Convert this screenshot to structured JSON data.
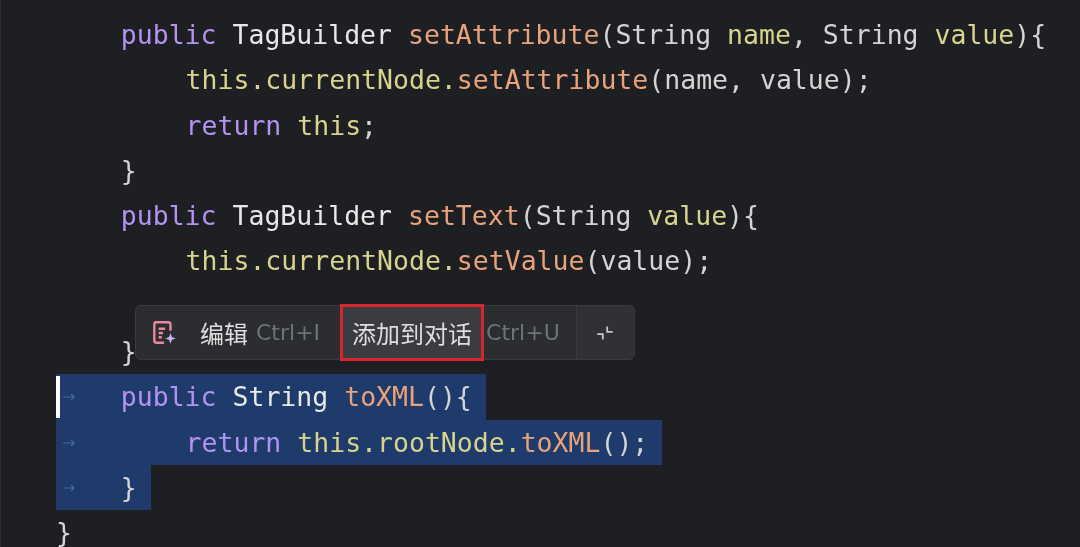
{
  "code_lines": [
    {
      "kind": "member",
      "selected": false,
      "caret": false,
      "tokens": [
        {
          "kind": "keyword",
          "text": "public "
        },
        {
          "kind": "type",
          "text": "TagBuilder "
        },
        {
          "kind": "method",
          "text": "setAttribute"
        },
        {
          "kind": "plain",
          "text": "(String "
        },
        {
          "kind": "field",
          "text": "name"
        },
        {
          "kind": "plain",
          "text": ", String "
        },
        {
          "kind": "field",
          "text": "value"
        },
        {
          "kind": "plain",
          "text": "){"
        }
      ]
    },
    {
      "kind": "statement",
      "selected": false,
      "caret": false,
      "tokens": [
        {
          "kind": "field",
          "text": "this.currentNode."
        },
        {
          "kind": "method",
          "text": "setAttribute"
        },
        {
          "kind": "plain",
          "text": "(name, value);"
        }
      ]
    },
    {
      "kind": "statement",
      "selected": false,
      "caret": false,
      "tokens": [
        {
          "kind": "keyword",
          "text": "return "
        },
        {
          "kind": "field",
          "text": "this"
        },
        {
          "kind": "plain",
          "text": ";"
        }
      ]
    },
    {
      "kind": "member",
      "selected": false,
      "caret": false,
      "tokens": [
        {
          "kind": "plain",
          "text": "}"
        }
      ]
    },
    {
      "kind": "member",
      "selected": false,
      "caret": false,
      "tokens": [
        {
          "kind": "keyword",
          "text": "public "
        },
        {
          "kind": "type",
          "text": "TagBuilder "
        },
        {
          "kind": "method",
          "text": "setText"
        },
        {
          "kind": "plain",
          "text": "(String "
        },
        {
          "kind": "field",
          "text": "value"
        },
        {
          "kind": "plain",
          "text": "){"
        }
      ]
    },
    {
      "kind": "statement",
      "selected": false,
      "caret": false,
      "tokens": [
        {
          "kind": "field",
          "text": "this.currentNode."
        },
        {
          "kind": "method",
          "text": "setValue"
        },
        {
          "kind": "plain",
          "text": "(value);"
        }
      ]
    }
  ],
  "code_lines_below": [
    {
      "kind": "member",
      "selected": false,
      "caret": false,
      "tokens": [
        {
          "kind": "plain",
          "text": "}"
        }
      ]
    },
    {
      "kind": "member",
      "selected": true,
      "caret": true,
      "tokens": [
        {
          "kind": "keyword",
          "text": "public "
        },
        {
          "kind": "type",
          "text": "String "
        },
        {
          "kind": "method",
          "text": "toXML"
        },
        {
          "kind": "plain",
          "text": "(){"
        }
      ]
    },
    {
      "kind": "statement",
      "selected": true,
      "caret": false,
      "tokens": [
        {
          "kind": "keyword",
          "text": "return "
        },
        {
          "kind": "field",
          "text": "this.rootNode."
        },
        {
          "kind": "method",
          "text": "toXML"
        },
        {
          "kind": "plain",
          "text": "();"
        }
      ]
    },
    {
      "kind": "member",
      "selected": true,
      "caret": false,
      "tokens": [
        {
          "kind": "plain",
          "text": "}"
        }
      ]
    },
    {
      "kind": "top",
      "selected": false,
      "caret": false,
      "tokens": [
        {
          "kind": "plain",
          "text": "}"
        }
      ]
    }
  ],
  "popup": {
    "actions": [
      {
        "label": "编辑",
        "shortcut": "Ctrl+I",
        "highlighted": false
      },
      {
        "label": "添加到对话",
        "shortcut": "Ctrl+U",
        "highlighted": true
      }
    ]
  }
}
